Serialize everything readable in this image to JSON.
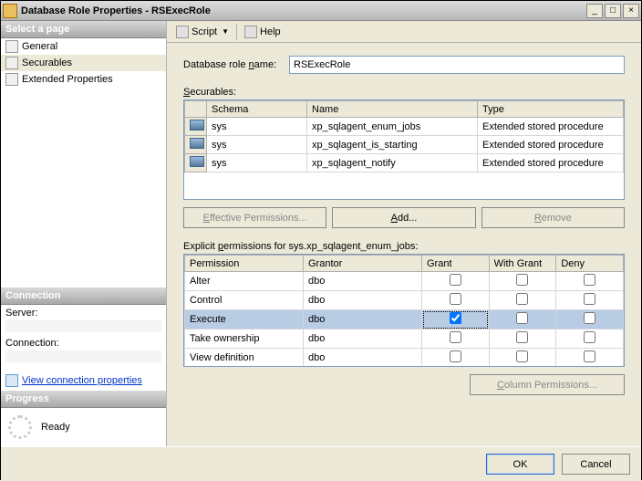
{
  "window": {
    "title": "Database Role Properties - RSExecRole",
    "min": "_",
    "max": "□",
    "close": "×"
  },
  "left": {
    "select_page": "Select a page",
    "nav": [
      {
        "label": "General"
      },
      {
        "label": "Securables"
      },
      {
        "label": "Extended Properties"
      }
    ],
    "connection_hdr": "Connection",
    "server_lbl": "Server:",
    "server_val": " ",
    "connection_lbl": "Connection:",
    "connection_val": " ",
    "view_conn": "View connection properties",
    "progress_hdr": "Progress",
    "ready": "Ready"
  },
  "toolbar": {
    "script": "Script",
    "help": "Help"
  },
  "form": {
    "role_label": "Database role name:",
    "role_value": "RSExecRole",
    "securables_label": "Securables:",
    "sec_headers": {
      "schema": "Schema",
      "name": "Name",
      "type": "Type"
    },
    "securables": [
      {
        "schema": "sys",
        "name": "xp_sqlagent_enum_jobs",
        "type": "Extended stored procedure"
      },
      {
        "schema": "sys",
        "name": "xp_sqlagent_is_starting",
        "type": "Extended stored procedure"
      },
      {
        "schema": "sys",
        "name": "xp_sqlagent_notify",
        "type": "Extended stored procedure"
      }
    ],
    "btn_eff": "Effective Permissions...",
    "btn_add": "Add...",
    "btn_remove": "Remove",
    "explicit_label": "Explicit permissions for sys.xp_sqlagent_enum_jobs:",
    "perm_headers": {
      "perm": "Permission",
      "grantor": "Grantor",
      "grant": "Grant",
      "with": "With Grant",
      "deny": "Deny"
    },
    "permissions": [
      {
        "perm": "Alter",
        "grantor": "dbo",
        "grant": false,
        "with": false,
        "deny": false
      },
      {
        "perm": "Control",
        "grantor": "dbo",
        "grant": false,
        "with": false,
        "deny": false
      },
      {
        "perm": "Execute",
        "grantor": "dbo",
        "grant": true,
        "with": false,
        "deny": false
      },
      {
        "perm": "Take ownership",
        "grantor": "dbo",
        "grant": false,
        "with": false,
        "deny": false
      },
      {
        "perm": "View definition",
        "grantor": "dbo",
        "grant": false,
        "with": false,
        "deny": false
      }
    ],
    "btn_colperm": "Column Permissions..."
  },
  "footer": {
    "ok": "OK",
    "cancel": "Cancel"
  }
}
